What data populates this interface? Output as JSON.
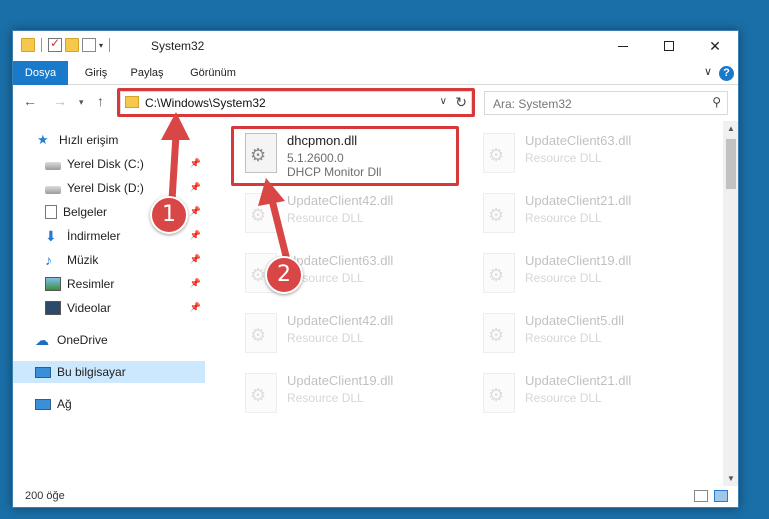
{
  "window": {
    "title": "System32"
  },
  "ribbon": {
    "tabs": [
      {
        "label": "Dosya",
        "active": true
      },
      {
        "label": "Giriş",
        "active": false
      },
      {
        "label": "Paylaş",
        "active": false
      },
      {
        "label": "Görünüm",
        "active": false
      }
    ],
    "help_glyph": "?",
    "expand_glyph": "∨"
  },
  "addressbar": {
    "path": "C:\\Windows\\System32",
    "search_placeholder": "Ara: System32"
  },
  "nav": {
    "items": [
      {
        "label": "Hızlı erişim",
        "icon": "quick-access-star-icon"
      },
      {
        "label": "Yerel Disk (C:)",
        "icon": "disk-icon",
        "pinned": true
      },
      {
        "label": "Yerel Disk (D:)",
        "icon": "disk-icon",
        "pinned": true
      },
      {
        "label": "Belgeler",
        "icon": "documents-icon",
        "pinned": true
      },
      {
        "label": "İndirmeler",
        "icon": "downloads-icon",
        "pinned": true
      },
      {
        "label": "Müzik",
        "icon": "music-icon",
        "pinned": true
      },
      {
        "label": "Resimler",
        "icon": "pictures-icon",
        "pinned": true
      },
      {
        "label": "Videolar",
        "icon": "videos-icon",
        "pinned": true
      },
      {
        "label": "OneDrive",
        "icon": "onedrive-icon"
      },
      {
        "label": "Bu bilgisayar",
        "icon": "this-pc-icon",
        "selected": true
      },
      {
        "label": "Ağ",
        "icon": "network-icon"
      }
    ]
  },
  "files": {
    "highlighted": {
      "name": "dhcpmon.dll",
      "version": "5.1.2600.0",
      "description": "DHCP Monitor Dll"
    },
    "others": [
      {
        "name": "UpdateClient63.dll",
        "type": "Resource DLL"
      },
      {
        "name": "UpdateClient42.dll",
        "type": "Resource DLL"
      },
      {
        "name": "UpdateClient21.dll",
        "type": "Resource DLL"
      },
      {
        "name": "UpdateClient63.dll",
        "type": "Resource DLL"
      },
      {
        "name": "UpdateClient19.dll",
        "type": "Resource DLL"
      },
      {
        "name": "UpdateClient42.dll",
        "type": "Resource DLL"
      },
      {
        "name": "UpdateClient5.dll",
        "type": "Resource DLL"
      },
      {
        "name": "UpdateClient19.dll",
        "type": "Resource DLL"
      },
      {
        "name": "UpdateClient21.dll",
        "type": "Resource DLL"
      }
    ]
  },
  "status": {
    "item_count": "200 öğe"
  },
  "callouts": {
    "one": "1",
    "two": "2"
  },
  "colors": {
    "accent": "#1979ca",
    "annotation_red": "#d9383a",
    "selection": "#cce8ff"
  }
}
